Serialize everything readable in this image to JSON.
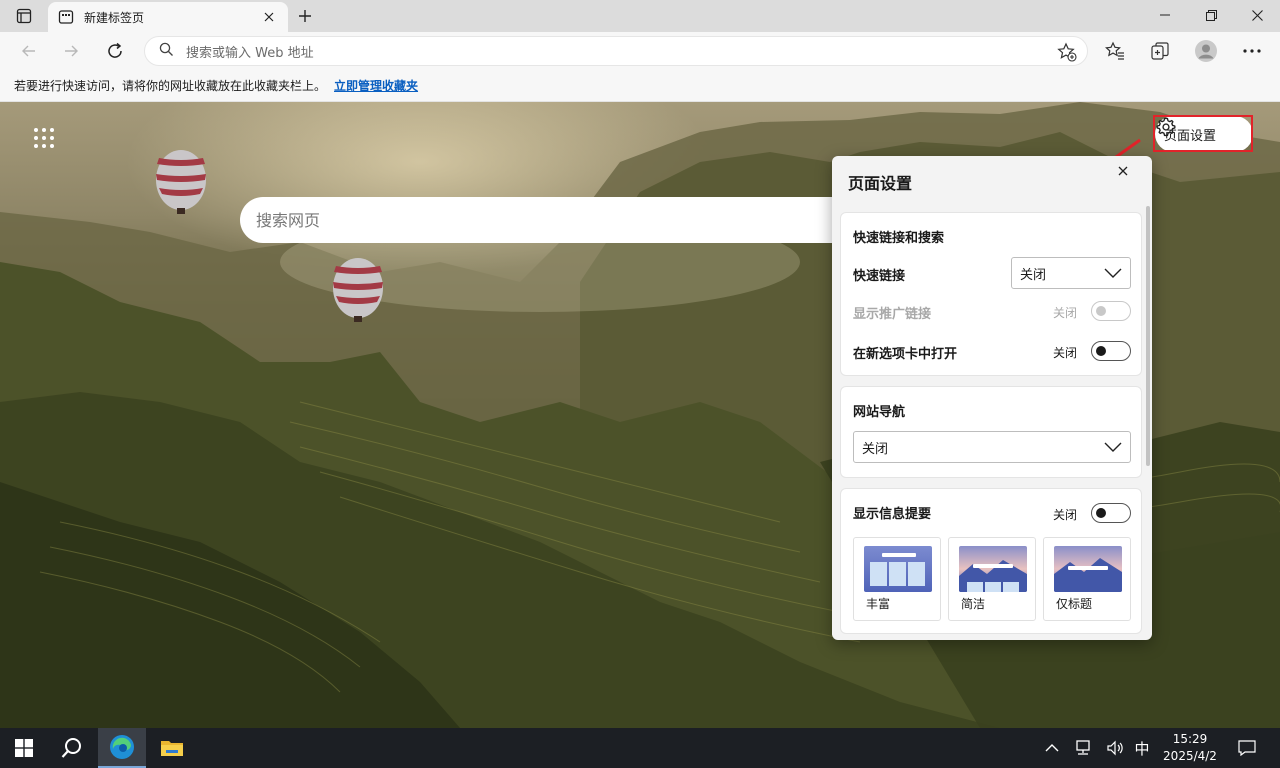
{
  "browser": {
    "tab_title": "新建标签页",
    "address_placeholder": "搜索或输入 Web 地址"
  },
  "favorites_bar": {
    "message": "若要进行快速访问，请将你的网址收藏放在此收藏夹栏上。",
    "link": "立即管理收藏夹"
  },
  "newtab": {
    "search_placeholder": "搜索网页",
    "page_settings_label": "页面设置"
  },
  "panel": {
    "title": "页面设置",
    "quicklinks_section": {
      "heading": "快速链接和搜索",
      "quicklinks_label": "快速链接",
      "quicklinks_value": "关闭",
      "promoted_label": "显示推广链接",
      "promoted_state": "关闭",
      "newtab_open_label": "在新选项卡中打开",
      "newtab_open_state": "关闭"
    },
    "site_nav_section": {
      "heading": "网站导航",
      "value": "关闭"
    },
    "info_section": {
      "heading": "显示信息提要",
      "state": "关闭",
      "layouts": [
        "丰富",
        "简洁",
        "仅标题"
      ]
    }
  },
  "taskbar": {
    "time": "15:29",
    "date": "2025/4/2",
    "ime": "中"
  },
  "colors": {
    "accent_red": "#e2232a",
    "link_blue": "#0a5fc1"
  }
}
